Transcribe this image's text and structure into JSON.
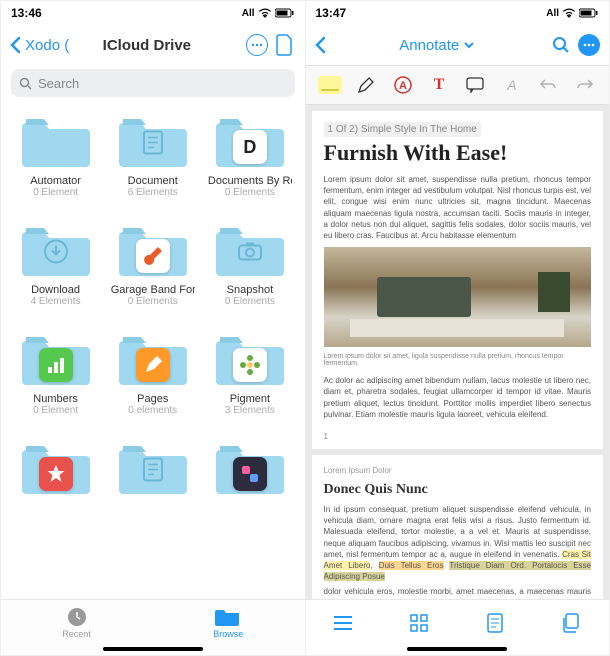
{
  "left": {
    "status": {
      "time": "13:46",
      "carrier": "All"
    },
    "nav": {
      "back_label": "Xodo (",
      "title": "ICloud Drive"
    },
    "search": {
      "placeholder": "Search"
    },
    "folders": [
      {
        "name": "Automator",
        "sub": "0 Element",
        "overlay": null
      },
      {
        "name": "Document",
        "sub": "6 Elements",
        "overlay": null,
        "inner": "doc"
      },
      {
        "name": "Documents By Readdle",
        "sub": "0 Elements",
        "overlay": {
          "bg": "#fff",
          "fg": "#222",
          "text": "D"
        }
      },
      {
        "name": "Download",
        "sub": "4 Elements",
        "overlay": null,
        "inner": "download"
      },
      {
        "name": "Garage Band For IOS",
        "sub": "0 Elements",
        "overlay": {
          "bg": "#fff",
          "fg": "#e85c2b",
          "svg": "guitar"
        }
      },
      {
        "name": "Snapshot",
        "sub": "0 Elements",
        "overlay": null,
        "inner": "camera"
      },
      {
        "name": "Numbers",
        "sub": "0 Element",
        "overlay": {
          "bg": "#55c94e",
          "fg": "#fff",
          "svg": "chart"
        }
      },
      {
        "name": "Pages",
        "sub": "0 elements",
        "overlay": {
          "bg": "#ff9a28",
          "fg": "#fff",
          "svg": "pen"
        }
      },
      {
        "name": "Pigment",
        "sub": "3 Elements",
        "overlay": {
          "bg": "#fff",
          "fg": "#6a4",
          "svg": "flower"
        }
      },
      {
        "name": "",
        "sub": "",
        "overlay": {
          "bg": "#e8514c",
          "fg": "#fff",
          "svg": "star"
        }
      },
      {
        "name": "",
        "sub": "",
        "overlay": null,
        "inner": "doc"
      },
      {
        "name": "",
        "sub": "",
        "overlay": {
          "bg": "#2c2c3e",
          "fg": "#fff",
          "svg": "shortcuts"
        }
      }
    ],
    "tabs": {
      "recent": "Recent",
      "browse": "Browse"
    }
  },
  "right": {
    "status": {
      "time": "13:47",
      "carrier": "All"
    },
    "nav": {
      "title": "Annotate"
    },
    "doc": {
      "breadcrumb": "1 Of 2) Simple Style In The Home",
      "heading": "Furnish With Ease!",
      "p1": "Lorem ipsum dolor sit amet, suspendisse nulla pretium, rhoncus tempor fermentum, enim integer ad vestibulum volutpat. Nisl rhoncus turpis est, vel elit, congue wisi enim nunc ultricies sit, magna tincidunt. Maecenas aliquam maecenas ligula nostra, accumsan taciti. Sociis mauris in integer, a dolor netus non dui aliquet, sagittis felis sodales, dolor sociis mauris, vel eu libero cras. Faucibus at. Arcu habitasse elementum",
      "caption": "Lorem ipsum dolor sit amet, ligula suspendisse nulla pretium, rhoncus tempor fermentum.",
      "p2": "Ac dolor ac adipiscing amet bibendum nullam, lacus molestie ut libero nec, diam et, pharetra sodales, feugiat ullamcorper id tempor id vitae. Mauris pretium aliquet, lectus tincidunt. Porttitor mollis imperdiet libero senectus pulvinar. Etiam molestie mauris ligula laoreet, vehicula eleifend.",
      "page_num": "1",
      "p3_label": "Lorem Ipsum Dolor",
      "h2": "Donec Quis Nunc",
      "p4": "In id ipsum consequat, pretium aliquet suspendisse eleifend vehicula, in vehicula diam, ornare magna erat felis wisi a risus. Justo fermentum id. Malesuada eleifend, tortor molestie, a a vel et. Mauris at suspendisse, neque aliquam faucibus adipiscing, vivamus in. Wisi mattis leo suscipit nec amet, nisl fermentum tempor ac a, augue in eleifend in venenatis.",
      "hl_yellow": "Cras Sit Amet Libero",
      "hl_orange": "Duis Tellus Eros",
      "hl_olive": "Tristique Diam Ord. Portalocis Esse Adipiscing Posue",
      "p5": "dolor vehicula eros, molestie morbi, amet maecenas, a maecenas mauris neque proin nisl mollis."
    }
  }
}
